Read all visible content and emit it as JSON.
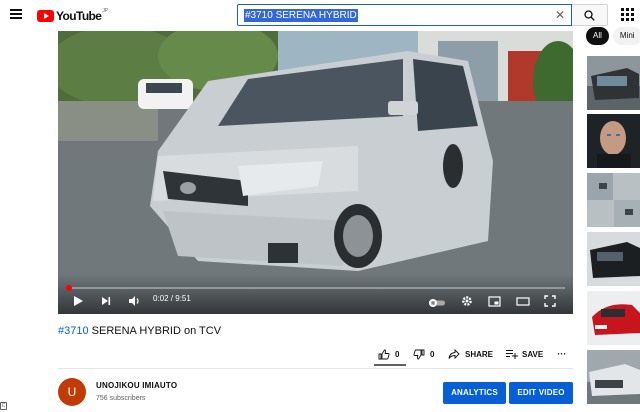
{
  "header": {
    "logo_text": "YouTube",
    "logo_region": "JP",
    "search_query": "#3710 SERENA HYBRID",
    "icons": [
      "menu-icon",
      "search-icon",
      "clear-icon",
      "apps-icon"
    ]
  },
  "player": {
    "current_time": "0:02",
    "duration": "9:51",
    "time_display": "0:02 / 9:51",
    "progress_fraction": 0.0034,
    "buffered_fraction": 0.07
  },
  "video": {
    "title_tag": "#3710",
    "title_rest": " SERENA HYBRID on TCV",
    "like_count": "0",
    "dislike_count": "0",
    "share_label": "SHARE",
    "save_label": "SAVE",
    "more_label": "···"
  },
  "channel": {
    "avatar_letter": "U",
    "name": "UNOJIKOU IMIAUTO",
    "subscribers": "756 subscribers",
    "analytics_label": "ANALYTICS",
    "edit_label": "EDIT VIDEO"
  },
  "sidebar": {
    "chips": [
      "All",
      "Mini"
    ]
  },
  "colors": {
    "accent_blue": "#065fd4",
    "brand_red": "#ff0000",
    "avatar": "#c13b06"
  }
}
